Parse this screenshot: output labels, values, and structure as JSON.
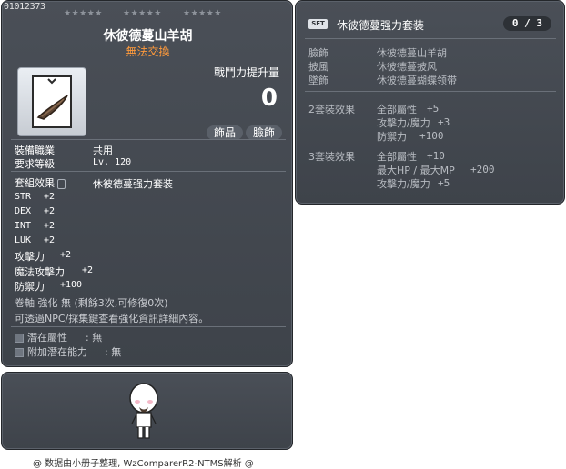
{
  "item": {
    "code": "01012373",
    "stars": [
      "★★★★★",
      "★★★★★",
      "★★★★★"
    ],
    "name": "休彼德蔓山羊胡",
    "trade_status": "無法交換",
    "power_label": "戰鬥力提升量",
    "power_value": "0",
    "tags": [
      "飾品",
      "臉飾"
    ],
    "job_label": "裝備職業",
    "job_value": "共用",
    "level_label": "要求等級",
    "level_value": "Lv. 120",
    "set_effect_label": "套組效果",
    "set_name": "休彼德蔓强力套装",
    "stats": [
      {
        "label": "STR",
        "value": "+2"
      },
      {
        "label": "DEX",
        "value": "+2"
      },
      {
        "label": "INT",
        "value": "+2"
      },
      {
        "label": "LUK",
        "value": "+2"
      },
      {
        "label": "攻擊力",
        "value": "+2"
      },
      {
        "label": "魔法攻擊力",
        "value": "+2"
      },
      {
        "label": "防禦力",
        "value": "+100"
      }
    ],
    "scroll_line": "卷軸 強化 無 (剩餘3次,可修復0次)",
    "info_line": "可透過NPC/採集鍵查看強化資訊詳細內容。",
    "potential_label": "潛在屬性",
    "potential_value": ": 無",
    "additional_potential_label": "附加潛在能力",
    "additional_potential_value": ": 無"
  },
  "set": {
    "badge": "SET",
    "title": "休彼德蔓强力套装",
    "count": "0 / 3",
    "pieces": [
      {
        "slot": "臉飾",
        "name": "休彼德蔓山羊胡"
      },
      {
        "slot": "披風",
        "name": "休彼德蔓披风"
      },
      {
        "slot": "墜飾",
        "name": "休彼德蔓蝴蝶领带"
      }
    ],
    "effects": [
      {
        "label": "2套裝效果",
        "lines": [
          {
            "stat": "全部屬性",
            "value": "+5"
          },
          {
            "stat": "攻擊力/魔力",
            "value": "+3"
          },
          {
            "stat": "防禦力",
            "value": "+100"
          }
        ]
      },
      {
        "label": "3套裝效果",
        "lines": [
          {
            "stat": "全部屬性",
            "value": "+10"
          },
          {
            "stat": "最大HP / 最大MP",
            "value": "+200"
          },
          {
            "stat": "攻擊力/魔力",
            "value": "+5"
          }
        ]
      }
    ]
  },
  "footer": "@ 数据由小册子整理, WzComparerR2-NTMS解析 @",
  "colors": {
    "panel_bg": "#454a51",
    "trade_orange": "#ff9a3b",
    "set_text": "#b8bcc2"
  }
}
